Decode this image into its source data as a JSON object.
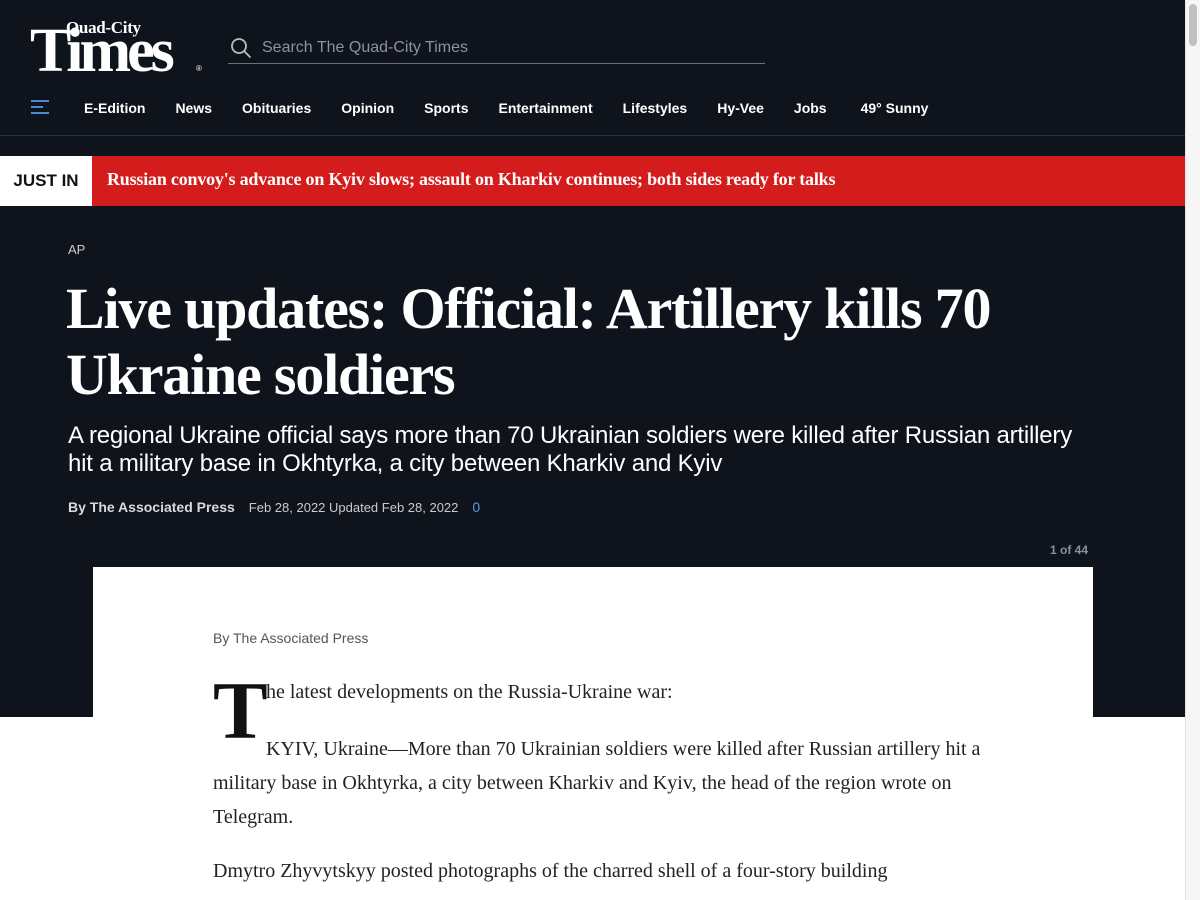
{
  "header": {
    "logo_small": "Quad-City",
    "logo_big": "Times",
    "logo_reg": "®",
    "search_placeholder": "Search The Quad-City Times"
  },
  "nav": {
    "items": [
      "E-Edition",
      "News",
      "Obituaries",
      "Opinion",
      "Sports",
      "Entertainment",
      "Lifestyles",
      "Hy-Vee",
      "Jobs"
    ],
    "weather": "49° Sunny"
  },
  "just_in": {
    "label": "JUST IN",
    "headline": "Russian convoy's advance on Kyiv slows; assault on Kharkiv continues; both sides ready for talks"
  },
  "article": {
    "source": "AP",
    "title": "Live updates: Official: Artillery kills 70 Ukraine soldiers",
    "subtitle": "A regional Ukraine official says more than 70 Ukrainian soldiers were killed after Russian artillery hit a military base in Okhtyrka, a city between Kharkiv and Kyiv",
    "author": "By The Associated Press",
    "dates": "Feb 28, 2022 Updated Feb 28, 2022",
    "comments": "0",
    "gallery_count": "1 of 44"
  },
  "body": {
    "byline": "By The Associated Press",
    "dropcap": "T",
    "para1": "he latest developments on the Russia-Ukraine war:",
    "para2": "KYIV, Ukraine—More than 70 Ukrainian soldiers were killed after Russian artillery hit a military base in Okhtyrka, a city between Kharkiv and Kyiv, the head of the region wrote on Telegram.",
    "para3": "Dmytro Zhyvytskyy posted photographs of the charred shell of a four-story building"
  },
  "colors": {
    "background_dark": "#0e131c",
    "just_in_red": "#d51c1c",
    "accent_blue": "#4d8ad6"
  },
  "icons": {
    "search": "search-icon",
    "menu": "hamburger-menu-icon"
  }
}
